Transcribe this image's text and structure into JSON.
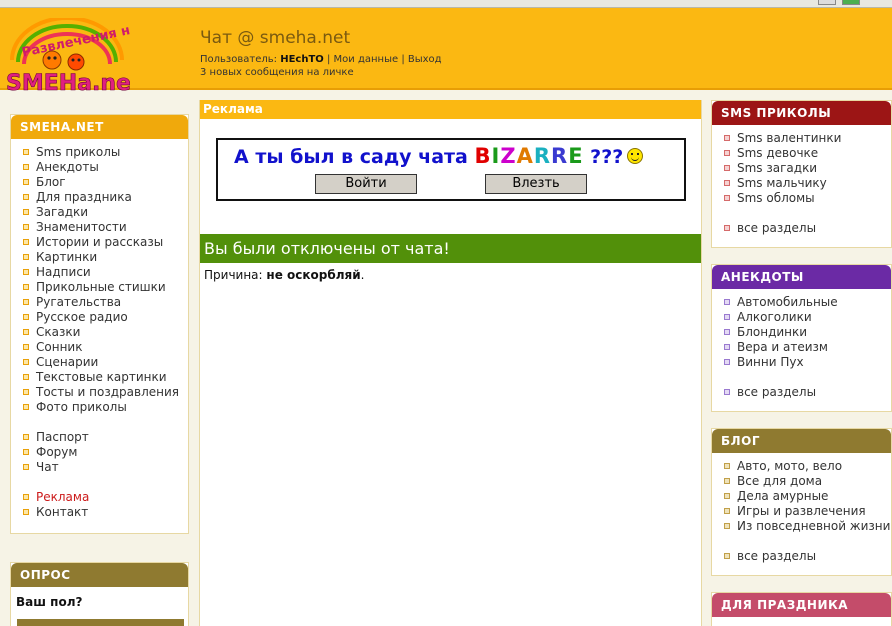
{
  "header": {
    "logo_top": "Развлечения на",
    "logo_bottom": "SMEHa.net",
    "title": "Чат @ smeha.net",
    "user_label": "Пользователь:",
    "user_name": "HEchTO",
    "sep": "|",
    "my_data": "Мои данные",
    "logout": "Выход",
    "messages": "3 новых сообщения на личке"
  },
  "left": {
    "title": "SMEHA.NET",
    "items": [
      "Sms приколы",
      "Анекдоты",
      "Блог",
      "Для праздника",
      "Загадки",
      "Знаменитости",
      "Истории и рассказы",
      "Картинки",
      "Надписи",
      "Прикольные стишки",
      "Ругательства",
      "Русское радио",
      "Сказки",
      "Сонник",
      "Сценарии",
      "Текстовые картинки",
      "Тосты и поздравления",
      "Фото приколы"
    ],
    "items2": [
      "Паспорт",
      "Форум",
      "Чат"
    ],
    "items3": [
      "Реклама",
      "Контакт"
    ]
  },
  "poll": {
    "title": "ОПРОС",
    "question": "Ваш пол?"
  },
  "center": {
    "ad_title": "Реклама",
    "banner_text": "А ты был в саду чата",
    "banner_brand": [
      "B",
      "I",
      "Z",
      "A",
      "R",
      "R",
      "E"
    ],
    "banner_brand_colors": [
      "#e00000",
      "#1a9a1a",
      "#cc00cc",
      "#e07a00",
      "#1ab0c0",
      "#3a3ad0",
      "#1a9a1a"
    ],
    "banner_q": "???",
    "btn_enter": "Войти",
    "btn_climb": "Влезть",
    "disconnected": "Вы были отключены от чата!",
    "reason_label": "Причина:",
    "reason_value": "не оскорбляй",
    "reason_end": "."
  },
  "right": {
    "sms": {
      "title": "SMS ПРИКОЛЫ",
      "items": [
        "Sms валентинки",
        "Sms девочке",
        "Sms загадки",
        "Sms мальчику",
        "Sms обломы"
      ],
      "all": "все разделы"
    },
    "jokes": {
      "title": "АНЕКДОТЫ",
      "items": [
        "Автомобильные",
        "Алкоголики",
        "Блондинки",
        "Вера и атеизм",
        "Винни Пух"
      ],
      "all": "все разделы"
    },
    "blog": {
      "title": "БЛОГ",
      "items": [
        "Авто, мото, вело",
        "Все для дома",
        "Дела амурные",
        "Игры и развлечения",
        "Из повседневной жизни"
      ],
      "all": "все разделы"
    },
    "holiday": {
      "title": "ДЛЯ ПРАЗДНИКА"
    }
  },
  "colors": {
    "header_bg": "#fbb812",
    "green_bar": "#52900a",
    "link_active": "#cc1a1a"
  }
}
